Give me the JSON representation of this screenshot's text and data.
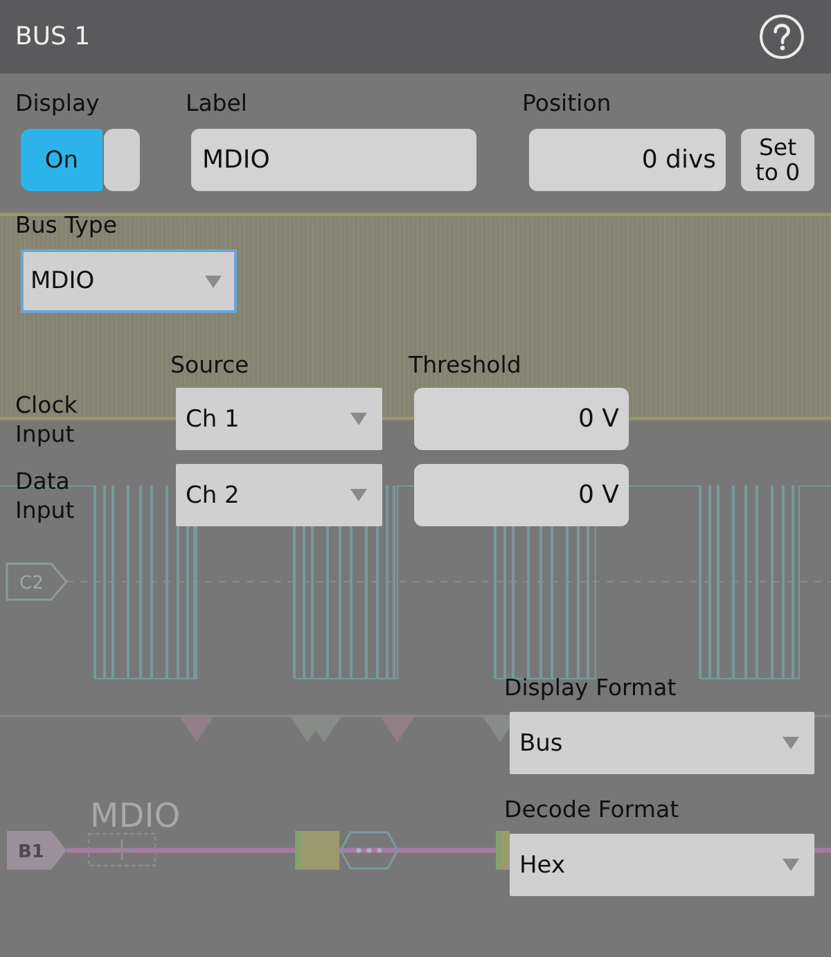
{
  "window": {
    "title": "BUS 1"
  },
  "display": {
    "label": "Display",
    "state_text": "On",
    "on": true
  },
  "label": {
    "label": "Label",
    "value": "MDIO"
  },
  "position": {
    "label": "Position",
    "value": "0 divs",
    "reset_button": "Set to 0"
  },
  "bus_type": {
    "label": "Bus Type",
    "value": "MDIO",
    "focused": true
  },
  "inputs": {
    "columns": [
      "Source",
      "Threshold"
    ],
    "rows": [
      {
        "label": "Clock Input",
        "source": "Ch 1",
        "threshold": "0 V"
      },
      {
        "label": "Data Input",
        "source": "Ch 2",
        "threshold": "0 V"
      }
    ]
  },
  "display_format": {
    "label": "Display Format",
    "value": "Bus"
  },
  "decode_format": {
    "label": "Decode Format",
    "value": "Hex"
  },
  "waveform": {
    "channel_badge": "C2",
    "bus_label": "MDIO",
    "bus_badge": "B1"
  }
}
